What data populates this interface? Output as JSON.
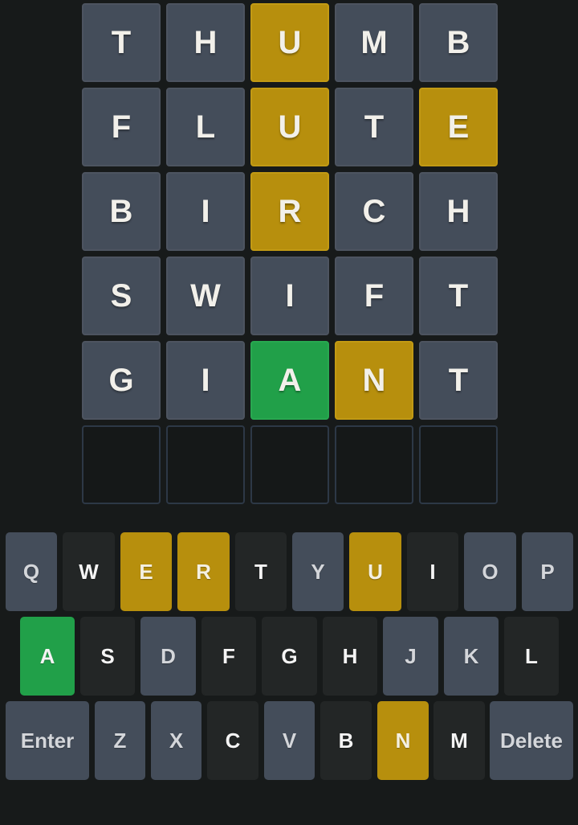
{
  "colors": {
    "background": "#171a1a",
    "absent_tile": "#444d5a",
    "present": "#b78f0d",
    "correct": "#21a049",
    "empty_border": "#2d3846",
    "absent_key": "#232626",
    "unused_key": "#444d5a"
  },
  "board": {
    "rows": [
      {
        "letters": [
          "T",
          "H",
          "U",
          "M",
          "B"
        ],
        "states": [
          "absent",
          "absent",
          "present",
          "absent",
          "absent"
        ]
      },
      {
        "letters": [
          "F",
          "L",
          "U",
          "T",
          "E"
        ],
        "states": [
          "absent",
          "absent",
          "present",
          "absent",
          "present"
        ]
      },
      {
        "letters": [
          "B",
          "I",
          "R",
          "C",
          "H"
        ],
        "states": [
          "absent",
          "absent",
          "present",
          "absent",
          "absent"
        ]
      },
      {
        "letters": [
          "S",
          "W",
          "I",
          "F",
          "T"
        ],
        "states": [
          "absent",
          "absent",
          "absent",
          "absent",
          "absent"
        ]
      },
      {
        "letters": [
          "G",
          "I",
          "A",
          "N",
          "T"
        ],
        "states": [
          "absent",
          "absent",
          "correct",
          "present",
          "absent"
        ]
      },
      {
        "letters": [
          "",
          "",
          "",
          "",
          ""
        ],
        "states": [
          "empty",
          "empty",
          "empty",
          "empty",
          "empty"
        ]
      }
    ]
  },
  "keyboard": {
    "rows": [
      [
        {
          "label": "Q",
          "state": "unused"
        },
        {
          "label": "W",
          "state": "absent"
        },
        {
          "label": "E",
          "state": "present"
        },
        {
          "label": "R",
          "state": "present"
        },
        {
          "label": "T",
          "state": "absent"
        },
        {
          "label": "Y",
          "state": "unused"
        },
        {
          "label": "U",
          "state": "present"
        },
        {
          "label": "I",
          "state": "absent"
        },
        {
          "label": "O",
          "state": "unused"
        },
        {
          "label": "P",
          "state": "unused"
        }
      ],
      [
        {
          "label": "A",
          "state": "correct"
        },
        {
          "label": "S",
          "state": "absent"
        },
        {
          "label": "D",
          "state": "unused"
        },
        {
          "label": "F",
          "state": "absent"
        },
        {
          "label": "G",
          "state": "absent"
        },
        {
          "label": "H",
          "state": "absent"
        },
        {
          "label": "J",
          "state": "unused"
        },
        {
          "label": "K",
          "state": "unused"
        },
        {
          "label": "L",
          "state": "absent"
        }
      ],
      [
        {
          "label": "Enter",
          "state": "unused"
        },
        {
          "label": "Z",
          "state": "unused"
        },
        {
          "label": "X",
          "state": "unused"
        },
        {
          "label": "C",
          "state": "absent"
        },
        {
          "label": "V",
          "state": "unused"
        },
        {
          "label": "B",
          "state": "absent"
        },
        {
          "label": "N",
          "state": "present"
        },
        {
          "label": "M",
          "state": "absent"
        },
        {
          "label": "Delete",
          "state": "unused"
        }
      ]
    ]
  }
}
